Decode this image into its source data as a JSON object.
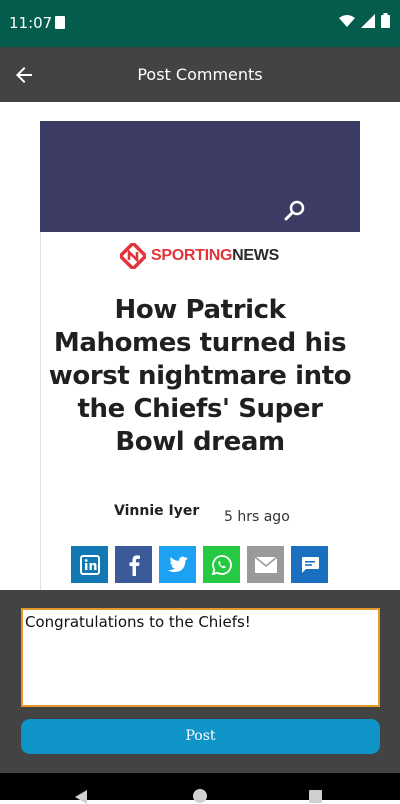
{
  "status_bar": {
    "time": "11:07"
  },
  "app_bar": {
    "title": "Post Comments"
  },
  "article": {
    "logo_sport": "SPORTING",
    "logo_news": "NEWS",
    "headline": "How Patrick Mahomes turned his worst nightmare into the Chiefs' Super Bowl dream",
    "author": "Vinnie Iyer",
    "time_ago": "5 hrs ago",
    "share_buttons": [
      {
        "icon": "linkedin-icon",
        "color": "#1178b3"
      },
      {
        "icon": "facebook-icon",
        "color": "#3b5a9a"
      },
      {
        "icon": "twitter-icon",
        "color": "#1da1f2"
      },
      {
        "icon": "whatsapp-icon",
        "color": "#26c943"
      },
      {
        "icon": "email-icon",
        "color": "#9a9a9a"
      },
      {
        "icon": "comment-icon",
        "color": "#1b6fc0"
      }
    ]
  },
  "comment": {
    "value": "Congratulations to the Chiefs!",
    "post_label": "Post"
  },
  "colors": {
    "status_bar": "#045c4c",
    "app_bar": "#434343",
    "hero": "#3c3c64",
    "post_button": "#0f94c8",
    "input_border": "#e49a2a"
  }
}
